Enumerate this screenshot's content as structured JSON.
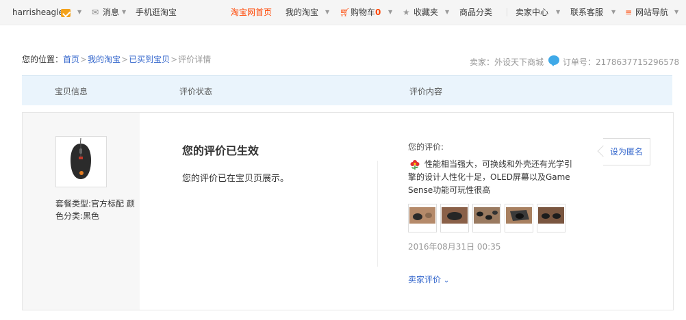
{
  "topbar": {
    "username": "harrisheagle",
    "messages": "消息",
    "mobile": "手机逛淘宝",
    "home": "淘宝网首页",
    "my_taobao": "我的淘宝",
    "cart": "购物车",
    "cart_count": "0",
    "favorites": "收藏夹",
    "categories": "商品分类",
    "seller_center": "卖家中心",
    "contact": "联系客服",
    "site_nav": "网站导航"
  },
  "breadcrumb": {
    "prefix": "您的位置：",
    "items": [
      "首页",
      "我的淘宝",
      "已买到宝贝"
    ],
    "current": "评价详情"
  },
  "order_info": {
    "seller": "卖家：外设天下商城",
    "order_number": "订单号：2178637715296578"
  },
  "table_header": {
    "item_info": "宝贝信息",
    "status": "评价状态",
    "content": "评价内容"
  },
  "product": {
    "attributes": "套餐类型:官方标配 颜色分类:黑色"
  },
  "status": {
    "title": "您的评价已生效",
    "description": "您的评价已在宝贝页展示。"
  },
  "review": {
    "label": "您的评价:",
    "text": "性能相当强大，可换线和外壳还有光学引擎的设计人性化十足，OLED屏幕以及Game Sense功能可玩性很高",
    "photo_count": 5,
    "date": "2016年08月31日 00:35",
    "seller_eval": "卖家评价",
    "anonymous_button": "设为匿名"
  },
  "colors": {
    "accent": "#ff4400",
    "link": "#3366cc",
    "header_bg": "#eaf4fc"
  }
}
